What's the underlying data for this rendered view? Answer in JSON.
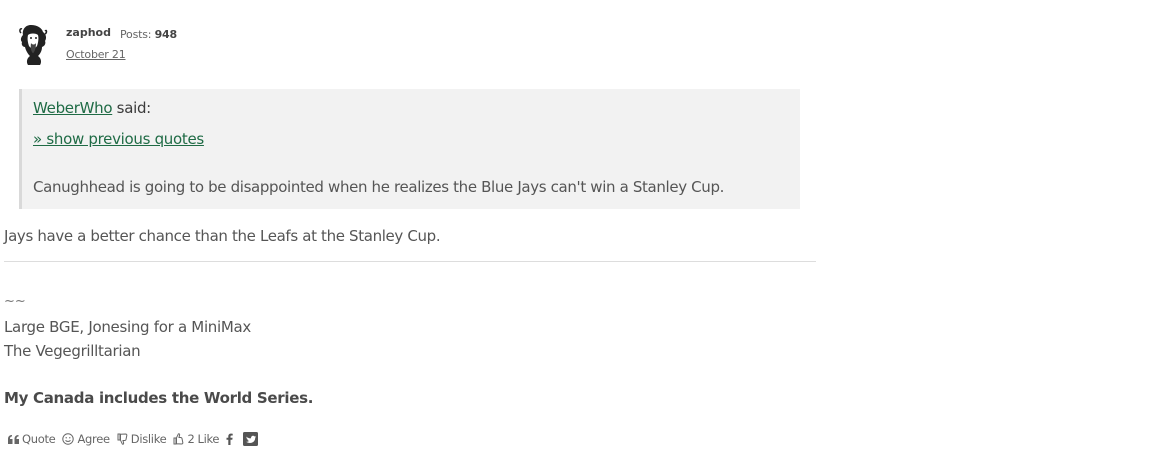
{
  "author": {
    "name": "zaphod",
    "posts_label": "Posts:",
    "posts_count": "948",
    "date": "October 21"
  },
  "quote": {
    "author": "WeberWho",
    "said": " said:",
    "show_previous": "» show previous quotes",
    "text": "Canughhead is going to be disappointed when he realizes the Blue Jays can't win a Stanley Cup."
  },
  "reply": {
    "text": "Jays have a better chance than the Leafs at the Stanley Cup."
  },
  "signature": {
    "tilde": "~~",
    "line1": "Large BGE, Jonesing for a MiniMax",
    "line2": "The Vegegrilltarian",
    "bold": "My Canada includes the World Series."
  },
  "reactions": {
    "quote_label": "Quote",
    "agree_label": "Agree",
    "dislike_label": "Dislike",
    "like_count": "2",
    "like_label": "Like",
    "share_icons": [
      "facebook-icon",
      "twitter-icon"
    ]
  }
}
